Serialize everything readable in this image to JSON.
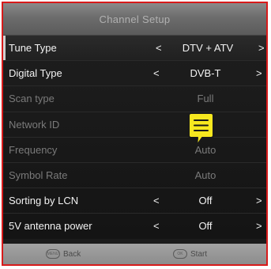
{
  "window": {
    "title": "Channel Setup"
  },
  "rows": [
    {
      "label": "Tune Type",
      "value": "DTV + ATV",
      "arrows": true,
      "state": "selected"
    },
    {
      "label": "Digital Type",
      "value": "DVB-T",
      "arrows": true,
      "state": "active"
    },
    {
      "label": "Scan type",
      "value": "Full",
      "arrows": false,
      "state": "disabled"
    },
    {
      "label": "Network ID",
      "value": "",
      "arrows": false,
      "state": "disabled"
    },
    {
      "label": "Frequency",
      "value": "Auto",
      "arrows": false,
      "state": "disabled"
    },
    {
      "label": "Symbol Rate",
      "value": "Auto",
      "arrows": false,
      "state": "disabled"
    },
    {
      "label": "Sorting by LCN",
      "value": "Off",
      "arrows": true,
      "state": "active"
    },
    {
      "label": "5V antenna power",
      "value": "Off",
      "arrows": true,
      "state": "active"
    }
  ],
  "footer": {
    "back_label": "Back",
    "back_key": "MENU",
    "start_label": "Start",
    "start_key": "OK"
  },
  "glyphs": {
    "left_arrow": "<",
    "right_arrow": ">"
  },
  "colors": {
    "frame": "#d81a1a",
    "note_icon": "#f7e81f"
  },
  "icons": {
    "overlay": "note-bubble-icon"
  }
}
